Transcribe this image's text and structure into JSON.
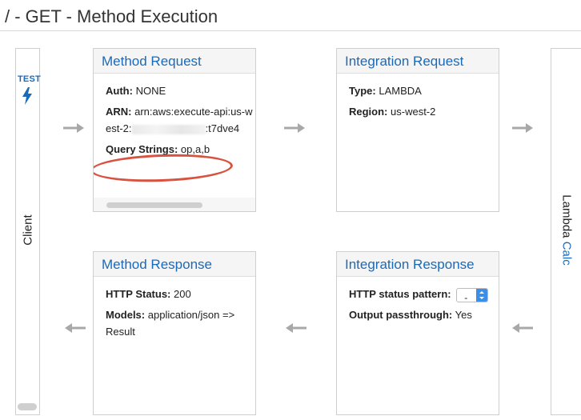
{
  "page": {
    "title": "/ - GET - Method Execution"
  },
  "client": {
    "test_label": "TEST",
    "label": "Client"
  },
  "lambda": {
    "prefix": "Lambda",
    "function_name": "Calc"
  },
  "method_request": {
    "title": "Method Request",
    "auth_label": "Auth:",
    "auth_value": "NONE",
    "arn_label": "ARN:",
    "arn_prefix": "arn:aws:execute-api:us-west-2:",
    "arn_suffix": ":t7dve4",
    "query_label": "Query Strings:",
    "query_value": "op,a,b"
  },
  "integration_request": {
    "title": "Integration Request",
    "type_label": "Type:",
    "type_value": "LAMBDA",
    "region_label": "Region:",
    "region_value": "us-west-2"
  },
  "method_response": {
    "title": "Method Response",
    "status_label": "HTTP Status:",
    "status_value": "200",
    "models_label": "Models:",
    "models_value": "application/json => Result"
  },
  "integration_response": {
    "title": "Integration Response",
    "pattern_label": "HTTP status pattern:",
    "pattern_value": "-",
    "passthrough_label": "Output passthrough:",
    "passthrough_value": "Yes"
  },
  "icons": {
    "test": "lightning-bolt-icon",
    "flow_right": "arrow-right-icon",
    "flow_left": "arrow-left-icon"
  },
  "colors": {
    "link_blue": "#1a6aba",
    "highlight_ring": "#d8523f",
    "arrow_gray": "#a8a8a8"
  }
}
